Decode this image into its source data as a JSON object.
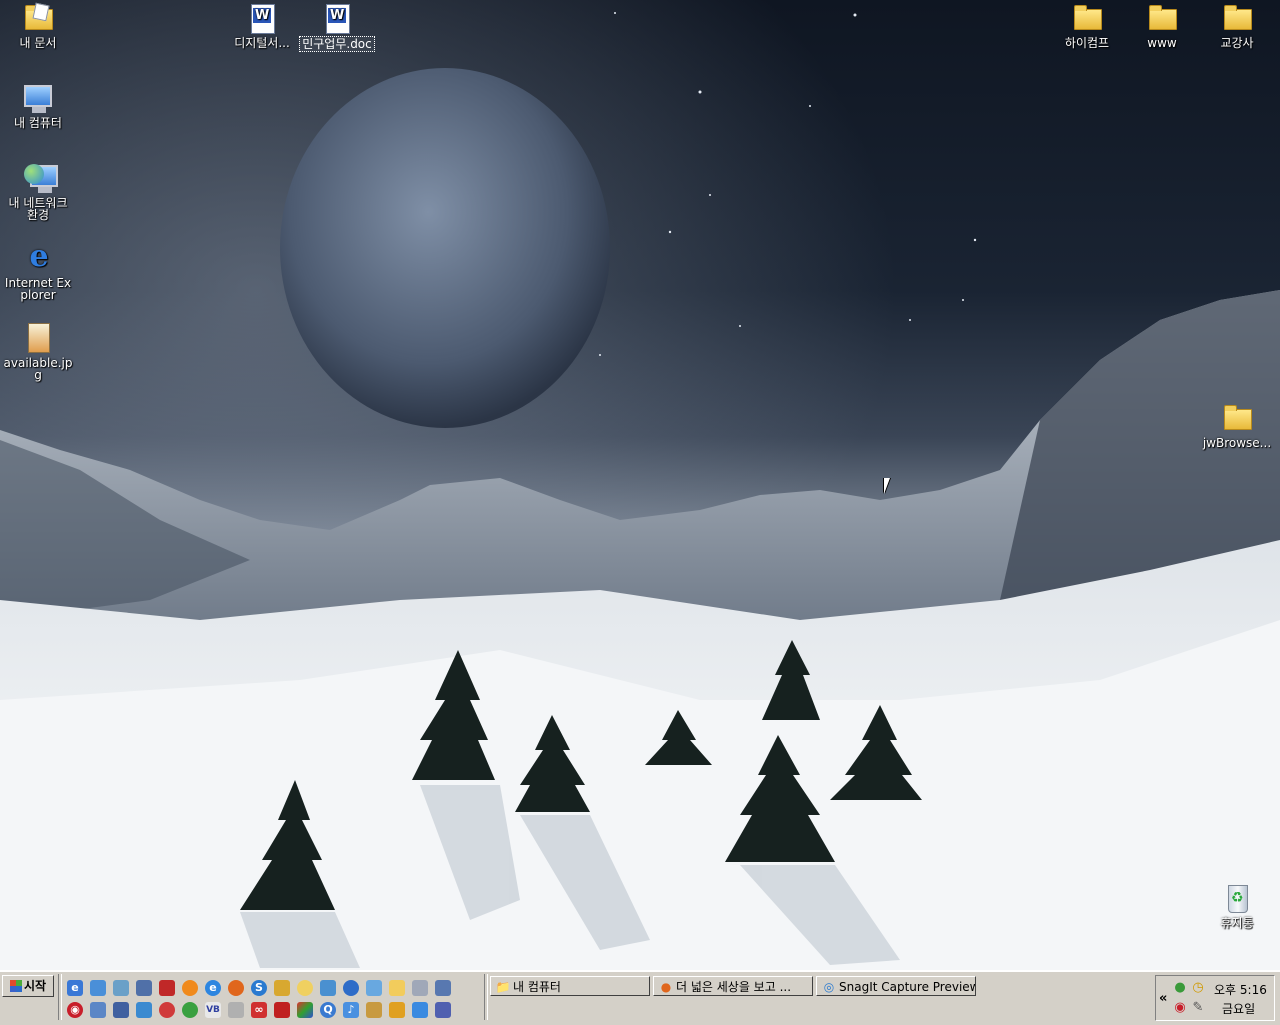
{
  "desktop": {
    "icons_left": [
      {
        "label": "내 문서",
        "icon": "my-documents-icon"
      },
      {
        "label": "내 컴퓨터",
        "icon": "my-computer-icon"
      },
      {
        "label": "내 네트워크 환경",
        "icon": "network-places-icon"
      },
      {
        "label": "Internet Explorer",
        "icon": "internet-explorer-icon"
      },
      {
        "label": "available.jpg",
        "icon": "jpg-file-icon"
      }
    ],
    "icons_top": [
      {
        "label": "디지털서...",
        "icon": "word-document-icon"
      },
      {
        "label": "민구업무.doc",
        "icon": "word-document-icon"
      }
    ],
    "icons_right": [
      {
        "label": "하이컴프",
        "icon": "folder-icon"
      },
      {
        "label": "www",
        "icon": "folder-icon"
      },
      {
        "label": "교강사",
        "icon": "folder-icon"
      },
      {
        "label": "jwBrowse...",
        "icon": "folder-icon"
      },
      {
        "label": "휴지통",
        "icon": "recycle-bin-icon"
      }
    ]
  },
  "taskbar": {
    "start_label": "시작",
    "tasks": [
      {
        "label": "내 컴퓨터",
        "icon": "folder-icon"
      },
      {
        "label": "더 넓은 세상을 보고 ...",
        "icon": "firefox-icon"
      },
      {
        "label": "SnagIt Capture Preview",
        "icon": "snagit-icon"
      }
    ],
    "tray": {
      "expand": "«",
      "time": "오후 5:16",
      "day": "금요일"
    }
  },
  "colors": {
    "taskbar": "#d4d0c8",
    "sky": "#1a2433",
    "snow": "#eef1f3"
  }
}
